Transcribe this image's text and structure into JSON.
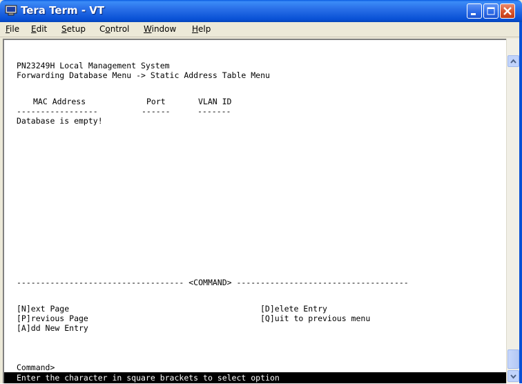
{
  "window": {
    "title": "Tera Term - VT",
    "accent_color": "#0850d5",
    "icons": {
      "app": "terminal-app-icon",
      "minimize": "minimize-icon",
      "maximize": "maximize-icon",
      "close": "close-icon"
    }
  },
  "menu": {
    "file": {
      "u": "F",
      "rest": "ile"
    },
    "edit": {
      "u": "E",
      "rest": "dit"
    },
    "setup": {
      "u": "S",
      "rest": "etup"
    },
    "control": {
      "pre": "C",
      "u": "o",
      "rest": "ntrol"
    },
    "window": {
      "u": "W",
      "rest": "indow"
    },
    "help": {
      "u": "H",
      "rest": "elp"
    }
  },
  "terminal": {
    "system_name": "PN23249H Local Management System",
    "breadcrumb": "Forwarding Database Menu -> Static Address Table Menu",
    "table": {
      "headers": [
        "MAC Address",
        "Port",
        "VLAN ID"
      ],
      "underlines": [
        "-----------------",
        "------",
        "-------"
      ],
      "empty_message": "Database is empty!"
    },
    "command_separator": "----------------------------------- <COMMAND> ------------------------------------",
    "commands": [
      "[N]ext Page",
      "[P]revious Page",
      "[A]dd New Entry",
      "[D]elete Entry",
      "[Q]uit to previous menu"
    ],
    "prompt": "Command>",
    "status_line": "Enter the character in square brackets to select option"
  }
}
